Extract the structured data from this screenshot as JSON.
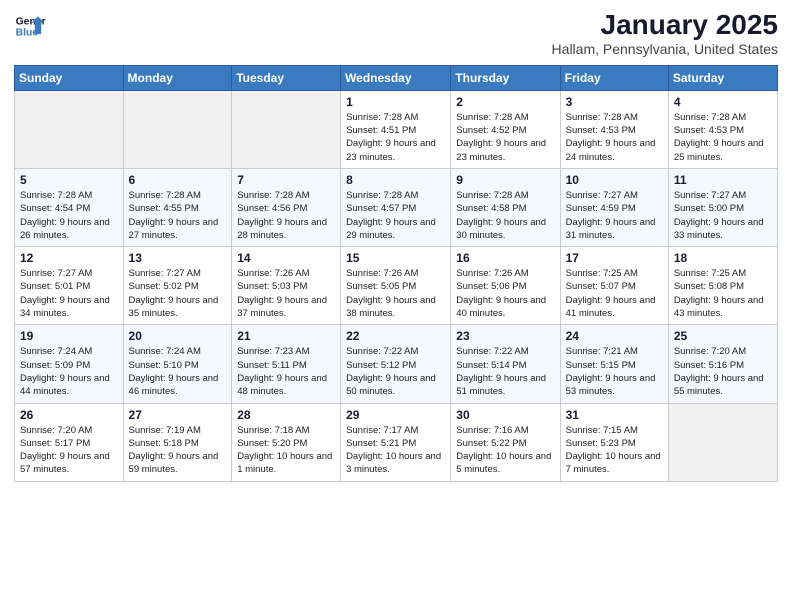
{
  "header": {
    "logo_line1": "General",
    "logo_line2": "Blue",
    "title": "January 2025",
    "subtitle": "Hallam, Pennsylvania, United States"
  },
  "days_of_week": [
    "Sunday",
    "Monday",
    "Tuesday",
    "Wednesday",
    "Thursday",
    "Friday",
    "Saturday"
  ],
  "weeks": [
    [
      {
        "day": "",
        "info": ""
      },
      {
        "day": "",
        "info": ""
      },
      {
        "day": "",
        "info": ""
      },
      {
        "day": "1",
        "info": "Sunrise: 7:28 AM\nSunset: 4:51 PM\nDaylight: 9 hours and 23 minutes."
      },
      {
        "day": "2",
        "info": "Sunrise: 7:28 AM\nSunset: 4:52 PM\nDaylight: 9 hours and 23 minutes."
      },
      {
        "day": "3",
        "info": "Sunrise: 7:28 AM\nSunset: 4:53 PM\nDaylight: 9 hours and 24 minutes."
      },
      {
        "day": "4",
        "info": "Sunrise: 7:28 AM\nSunset: 4:53 PM\nDaylight: 9 hours and 25 minutes."
      }
    ],
    [
      {
        "day": "5",
        "info": "Sunrise: 7:28 AM\nSunset: 4:54 PM\nDaylight: 9 hours and 26 minutes."
      },
      {
        "day": "6",
        "info": "Sunrise: 7:28 AM\nSunset: 4:55 PM\nDaylight: 9 hours and 27 minutes."
      },
      {
        "day": "7",
        "info": "Sunrise: 7:28 AM\nSunset: 4:56 PM\nDaylight: 9 hours and 28 minutes."
      },
      {
        "day": "8",
        "info": "Sunrise: 7:28 AM\nSunset: 4:57 PM\nDaylight: 9 hours and 29 minutes."
      },
      {
        "day": "9",
        "info": "Sunrise: 7:28 AM\nSunset: 4:58 PM\nDaylight: 9 hours and 30 minutes."
      },
      {
        "day": "10",
        "info": "Sunrise: 7:27 AM\nSunset: 4:59 PM\nDaylight: 9 hours and 31 minutes."
      },
      {
        "day": "11",
        "info": "Sunrise: 7:27 AM\nSunset: 5:00 PM\nDaylight: 9 hours and 33 minutes."
      }
    ],
    [
      {
        "day": "12",
        "info": "Sunrise: 7:27 AM\nSunset: 5:01 PM\nDaylight: 9 hours and 34 minutes."
      },
      {
        "day": "13",
        "info": "Sunrise: 7:27 AM\nSunset: 5:02 PM\nDaylight: 9 hours and 35 minutes."
      },
      {
        "day": "14",
        "info": "Sunrise: 7:26 AM\nSunset: 5:03 PM\nDaylight: 9 hours and 37 minutes."
      },
      {
        "day": "15",
        "info": "Sunrise: 7:26 AM\nSunset: 5:05 PM\nDaylight: 9 hours and 38 minutes."
      },
      {
        "day": "16",
        "info": "Sunrise: 7:26 AM\nSunset: 5:06 PM\nDaylight: 9 hours and 40 minutes."
      },
      {
        "day": "17",
        "info": "Sunrise: 7:25 AM\nSunset: 5:07 PM\nDaylight: 9 hours and 41 minutes."
      },
      {
        "day": "18",
        "info": "Sunrise: 7:25 AM\nSunset: 5:08 PM\nDaylight: 9 hours and 43 minutes."
      }
    ],
    [
      {
        "day": "19",
        "info": "Sunrise: 7:24 AM\nSunset: 5:09 PM\nDaylight: 9 hours and 44 minutes."
      },
      {
        "day": "20",
        "info": "Sunrise: 7:24 AM\nSunset: 5:10 PM\nDaylight: 9 hours and 46 minutes."
      },
      {
        "day": "21",
        "info": "Sunrise: 7:23 AM\nSunset: 5:11 PM\nDaylight: 9 hours and 48 minutes."
      },
      {
        "day": "22",
        "info": "Sunrise: 7:22 AM\nSunset: 5:12 PM\nDaylight: 9 hours and 50 minutes."
      },
      {
        "day": "23",
        "info": "Sunrise: 7:22 AM\nSunset: 5:14 PM\nDaylight: 9 hours and 51 minutes."
      },
      {
        "day": "24",
        "info": "Sunrise: 7:21 AM\nSunset: 5:15 PM\nDaylight: 9 hours and 53 minutes."
      },
      {
        "day": "25",
        "info": "Sunrise: 7:20 AM\nSunset: 5:16 PM\nDaylight: 9 hours and 55 minutes."
      }
    ],
    [
      {
        "day": "26",
        "info": "Sunrise: 7:20 AM\nSunset: 5:17 PM\nDaylight: 9 hours and 57 minutes."
      },
      {
        "day": "27",
        "info": "Sunrise: 7:19 AM\nSunset: 5:18 PM\nDaylight: 9 hours and 59 minutes."
      },
      {
        "day": "28",
        "info": "Sunrise: 7:18 AM\nSunset: 5:20 PM\nDaylight: 10 hours and 1 minute."
      },
      {
        "day": "29",
        "info": "Sunrise: 7:17 AM\nSunset: 5:21 PM\nDaylight: 10 hours and 3 minutes."
      },
      {
        "day": "30",
        "info": "Sunrise: 7:16 AM\nSunset: 5:22 PM\nDaylight: 10 hours and 5 minutes."
      },
      {
        "day": "31",
        "info": "Sunrise: 7:15 AM\nSunset: 5:23 PM\nDaylight: 10 hours and 7 minutes."
      },
      {
        "day": "",
        "info": ""
      }
    ]
  ]
}
